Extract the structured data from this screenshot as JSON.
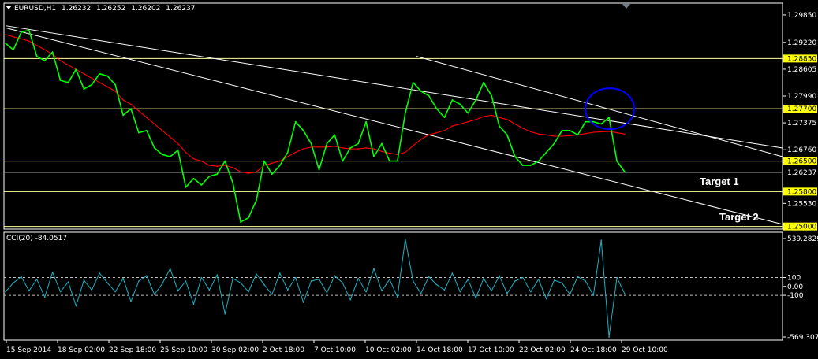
{
  "header": {
    "symbol": "EURUSD,H1",
    "open": "1.26232",
    "high": "1.26252",
    "low": "1.26202",
    "close": "1.26237"
  },
  "indicator": {
    "label": "CCI(20)",
    "value": "-84.0517"
  },
  "annotations": {
    "target1": "Target 1",
    "target2": "Target 2"
  },
  "colors": {
    "background": "#000000",
    "price": "#00ff00",
    "moving_average": "#ff0000",
    "trendline": "#ffffff",
    "level_line": "#ffff99",
    "level_label_bg": "#ffff00",
    "cci": "#1ab3c4",
    "highlight_circle": "#0000ff"
  },
  "chart_data": [
    {
      "type": "line",
      "series": [
        {
          "values": [
            1.292,
            1.2905,
            1.2945,
            1.295,
            1.289,
            1.288,
            1.29,
            1.2835,
            1.283,
            1.286,
            1.2815,
            1.2825,
            1.285,
            1.2845,
            1.2825,
            1.2755,
            1.277,
            1.2715,
            1.272,
            1.268,
            1.2665,
            1.266,
            1.2675,
            1.259,
            1.261,
            1.2595,
            1.2615,
            1.262,
            1.265,
            1.26,
            1.251,
            1.252,
            1.256,
            1.265,
            1.262,
            1.264,
            1.267,
            1.274,
            1.272,
            1.269,
            1.263,
            1.269,
            1.271,
            1.265,
            1.268,
            1.269,
            1.274,
            1.266,
            1.269,
            1.265,
            1.265,
            1.276,
            1.283,
            1.281,
            1.28,
            1.277,
            1.275,
            1.279,
            1.278,
            1.276,
            1.279,
            1.283,
            1.28,
            1.273,
            1.271,
            1.266,
            1.264,
            1.264,
            1.265,
            1.267,
            1.269,
            1.272,
            1.272,
            1.271,
            1.274,
            1.274,
            1.2735,
            1.275,
            1.265,
            1.2625
          ]
        },
        {
          "values": [
            1.294,
            1.2935,
            1.293,
            1.2925,
            1.2915,
            1.2905,
            1.2895,
            1.288,
            1.287,
            1.286,
            1.285,
            1.284,
            1.283,
            1.282,
            1.281,
            1.279,
            1.278,
            1.2765,
            1.275,
            1.2735,
            1.272,
            1.2705,
            1.269,
            1.267,
            1.2655,
            1.265,
            1.264,
            1.2638,
            1.264,
            1.2635,
            1.2625,
            1.2622,
            1.2625,
            1.264,
            1.2645,
            1.265,
            1.266,
            1.267,
            1.2678,
            1.2682,
            1.2682,
            1.2682,
            1.2684,
            1.268,
            1.2678,
            1.2678,
            1.268,
            1.2678,
            1.2672,
            1.2668,
            1.2665,
            1.267,
            1.2685,
            1.27,
            1.271,
            1.2715,
            1.272,
            1.273,
            1.2735,
            1.274,
            1.2745,
            1.2752,
            1.2755,
            1.275,
            1.2745,
            1.2735,
            1.2725,
            1.2717,
            1.2712,
            1.271,
            1.2707,
            1.2707,
            1.2708,
            1.271,
            1.2713,
            1.2716,
            1.2717,
            1.2718,
            1.2715,
            1.2712
          ]
        }
      ],
      "x_ticks": [
        "15 Sep 2014",
        "18 Sep 02:00",
        "22 Sep 18:00",
        "25 Sep 10:00",
        "30 Sep 02:00",
        "2 Oct 18:00",
        "7 Oct 10:00",
        "10 Oct 02:00",
        "14 Oct 18:00",
        "17 Oct 10:00",
        "22 Oct 02:00",
        "24 Oct 18:00",
        "29 Oct 10:00"
      ],
      "y_ticks": [
        "1.29850",
        "1.29220",
        "1.28605",
        "1.27990",
        "1.27375",
        "1.26760",
        "1.25530"
      ],
      "ylim": [
        1.2494,
        1.3012
      ],
      "horizontal_levels": [
        "1.28850",
        "1.27700",
        "1.26500",
        "1.25800",
        "1.25000"
      ],
      "current_price": "1.26237",
      "trendlines": [
        {
          "from": [
            "15 Sep 2014",
            1.296
          ],
          "to": [
            "end",
            1.268
          ]
        },
        {
          "from": [
            "14 Oct 18:00",
            1.289
          ],
          "to": [
            "end",
            1.266
          ]
        },
        {
          "from": [
            "15 Sep 2014",
            1.2955
          ],
          "to": [
            "end",
            1.2505
          ]
        }
      ],
      "highlight": {
        "shape": "circle",
        "around": "29 Oct 10:00",
        "price": 1.277
      },
      "grid": false
    },
    {
      "type": "line",
      "title": "CCI(20) -84.0517",
      "series": [
        {
          "values": [
            -60,
            40,
            110,
            -50,
            80,
            -120,
            160,
            -60,
            50,
            -220,
            70,
            -40,
            150,
            40,
            -60,
            90,
            -170,
            60,
            120,
            -90,
            30,
            200,
            -50,
            60,
            -200,
            100,
            -40,
            130,
            -310,
            90,
            40,
            -60,
            140,
            20,
            -90,
            150,
            -40,
            100,
            -180,
            60,
            80,
            -70,
            120,
            40,
            -150,
            90,
            -60,
            200,
            -50,
            80,
            -120,
            530,
            60,
            -80,
            110,
            20,
            -40,
            150,
            -60,
            80,
            -130,
            90,
            -50,
            120,
            -80,
            60,
            100,
            -60,
            80,
            -140,
            70,
            40,
            -90,
            110,
            60,
            -100,
            520,
            -570,
            100,
            -84
          ]
        }
      ],
      "y_ticks": [
        "539.2829",
        "100",
        "0.00",
        "-100",
        "-569.3071"
      ],
      "ylim": [
        -569.3071,
        539.2829
      ],
      "reference_levels": [
        100,
        -100
      ],
      "grid": false
    }
  ]
}
